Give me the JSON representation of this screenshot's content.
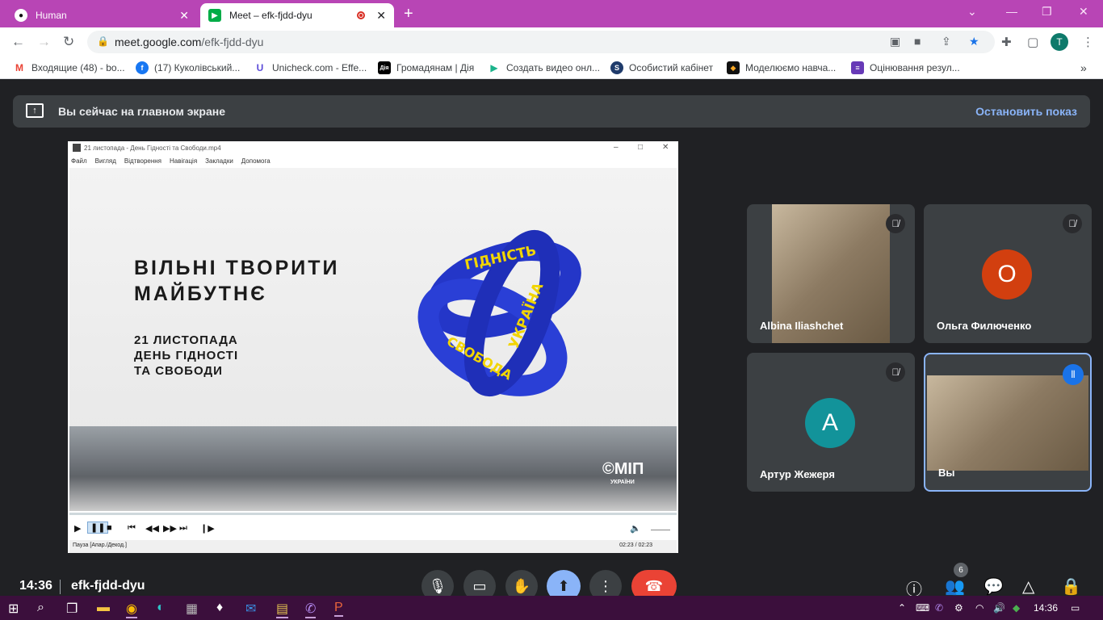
{
  "tabs": [
    {
      "label": "Human",
      "active": false
    },
    {
      "label": "Meet – efk-fjdd-dyu",
      "active": true
    }
  ],
  "address": {
    "domain": "meet.google.com",
    "path": "/efk-fjdd-dyu"
  },
  "profile_initial": "T",
  "bookmarks": [
    "Входящие (48) - bo...",
    "(17) Куколівський...",
    "Unicheck.com - Effe...",
    "Громадянам | Дія",
    "Создать видео онл...",
    "Особистий кабінет",
    "Моделюємо навча...",
    "Оцінювання резул..."
  ],
  "bookmark_icon_labels": {
    "diia": "Дія"
  },
  "banner": {
    "text": "Вы сейчас на главном экране",
    "stop": "Остановить показ"
  },
  "player": {
    "title": "21 листопада - День Гідності та Свободи.mp4",
    "menu": [
      "Файл",
      "Вигляд",
      "Відтворення",
      "Навігація",
      "Закладки",
      "Допомога"
    ],
    "headline_1": "ВІЛЬНІ ТВОРИТИ",
    "headline_2": "МАЙБУТНЄ",
    "sub_1": "21 ЛИСТОПАДА",
    "sub_2": "ДЕНЬ ГІДНОСТІ",
    "sub_3": "ТА СВОБОДИ",
    "ribbon_word_1": "ГІДНІСТЬ",
    "ribbon_word_2": "УКРАЇНА",
    "ribbon_word_3": "СВОБОДА",
    "logo": "©МІП",
    "logo_sub": "УКРАЇНИ",
    "status": "Пауза [Апар./Декод.]",
    "time": "02:23 / 02:23",
    "progress": 1.0
  },
  "participants": [
    {
      "name": "Albina Iliashchet",
      "muted": true,
      "video": true
    },
    {
      "name": "Ольга Филюченко",
      "muted": true,
      "initial": "О",
      "color": "#d23f0f"
    },
    {
      "name": "Артур Жежеря",
      "muted": true,
      "initial": "А",
      "color": "#12939a"
    },
    {
      "name": "Вы",
      "speaking": true,
      "video": true
    }
  ],
  "bottom": {
    "time": "14:36",
    "code": "efk-fjdd-dyu",
    "participants_count": "6"
  },
  "taskbar": {
    "time": "14:36"
  },
  "colors": {
    "chrome_tab": "#b845b5",
    "meet_bg": "#202124",
    "accent": "#8ab4f8",
    "leave": "#ea4335",
    "taskbar": "#3b0f3c"
  }
}
